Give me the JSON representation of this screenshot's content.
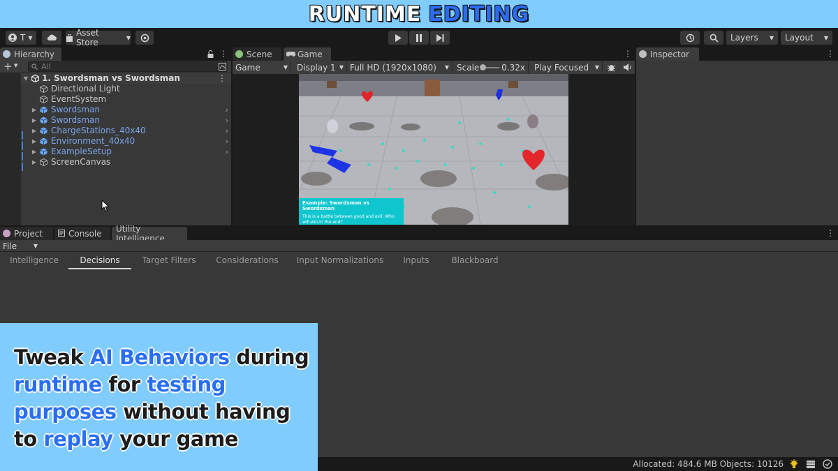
{
  "banner": {
    "title_white": "RUNTIME",
    "title_blue": "EDITING"
  },
  "toolbar": {
    "account_label": "T",
    "asset_store_label": "Asset Store",
    "layers_label": "Layers",
    "layout_label": "Layout",
    "icons": [
      "account-icon",
      "cloud-icon",
      "settings-icon",
      "play-icon",
      "pause-icon",
      "step-icon",
      "history-icon",
      "search-icon"
    ]
  },
  "hierarchy": {
    "tab_label": "Hierarchy",
    "search_placeholder": "All",
    "scene_name": "1. Swordsman vs Swordsman",
    "items": [
      {
        "label": "Directional Light",
        "prefab": false,
        "expandable": false
      },
      {
        "label": "EventSystem",
        "prefab": false,
        "expandable": false
      },
      {
        "label": "Swordsman",
        "prefab": true,
        "expandable": true
      },
      {
        "label": "Swordsman",
        "prefab": true,
        "expandable": true
      },
      {
        "label": "ChargeStations_40x40",
        "prefab": true,
        "expandable": true
      },
      {
        "label": "Environment_40x40",
        "prefab": true,
        "expandable": true
      },
      {
        "label": "ExampleSetup",
        "prefab": true,
        "expandable": true
      },
      {
        "label": "ScreenCanvas",
        "prefab": false,
        "expandable": true
      }
    ]
  },
  "game_panel": {
    "tabs": [
      "Scene",
      "Game"
    ],
    "active_tab": "Game",
    "view_dropdown": "Game",
    "display_dropdown": "Display 1",
    "resolution_dropdown": "Full HD (1920x1080)",
    "scale_label": "Scale",
    "scale_value": "0.32x",
    "play_mode_dropdown": "Play Focused",
    "example_title": "Example: Swordsman vs Swordsman",
    "example_desc": "This is a battle between good and evil. Who will win in the end?"
  },
  "inspector": {
    "tab_label": "Inspector"
  },
  "bottom_panel": {
    "tabs": [
      "Project",
      "Console",
      "Utility Intelligence"
    ],
    "active_tab": "Utility Intelligence",
    "file_menu": "File",
    "subtabs": [
      "Intelligence",
      "Decisions",
      "Target Filters",
      "Considerations",
      "Input Normalizations",
      "Inputs",
      "Blackboard"
    ],
    "active_subtab": "Decisions"
  },
  "status": {
    "text": "Allocated: 484.6 MB Objects: 10126"
  },
  "overlay": {
    "line1_a": "Tweak ",
    "line1_hl": "AI Behaviors",
    "line1_b": " during",
    "line2_hl1": "runtime",
    "line2_mid": " for ",
    "line2_hl2": "testing",
    "line3_hl": "purposes",
    "line3_b": " without having",
    "line4_a": "to ",
    "line4_hl": "replay",
    "line4_b": " your game"
  },
  "colors": {
    "banner_bg": "#80ccfc",
    "highlight_blue": "#2a6ef2",
    "prefab_text": "#7ba4e8",
    "editor_bg": "#282828"
  }
}
